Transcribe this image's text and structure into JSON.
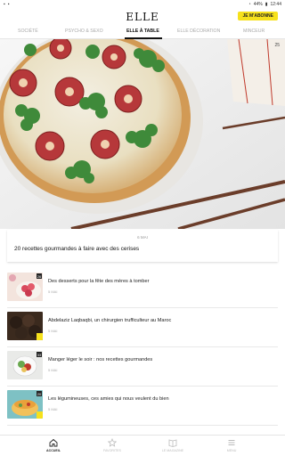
{
  "status_bar": {
    "battery": "44%",
    "time": "12:44"
  },
  "header": {
    "logo": "ELLE",
    "subscribe_label": "JE M'ABONNE"
  },
  "tabs": [
    {
      "label": "SOCIÉTÉ",
      "active": false
    },
    {
      "label": "PSYCHO & SEXO",
      "active": false
    },
    {
      "label": "ELLE À TABLE",
      "active": true
    },
    {
      "label": "ELLE DÉCORATION",
      "active": false
    },
    {
      "label": "MINCEUR",
      "active": false
    }
  ],
  "hero": {
    "badge": "25"
  },
  "feature": {
    "date": "6 MAI",
    "title": "20 recettes gourmandes à faire avec des cerises"
  },
  "articles": [
    {
      "title": "Des desserts pour la fête des mères à tomber",
      "meta": "5 MAI",
      "badge": "26"
    },
    {
      "title": "Abdelaziz Laqbaqbi, un chirurgien trufficulteur au Maroc",
      "meta": "5 MAI",
      "badge": ""
    },
    {
      "title": "Manger léger le soir : nos recettes gourmandes",
      "meta": "5 MAI",
      "badge": "33"
    },
    {
      "title": "Les légumineuses, ces amies qui nous veulent du bien",
      "meta": "5 MAI",
      "badge": "20"
    }
  ],
  "bottom_nav": [
    {
      "label": "ACCUEIL",
      "icon": "home-icon",
      "active": true
    },
    {
      "label": "FAVORITES",
      "icon": "star-icon",
      "active": false
    },
    {
      "label": "LE MAGAZINE",
      "icon": "magazine-icon",
      "active": false
    },
    {
      "label": "MENU",
      "icon": "menu-icon",
      "active": false
    }
  ],
  "colors": {
    "accent_yellow": "#f6e11c",
    "text_dark": "#111111",
    "text_muted": "#aaaaaa"
  }
}
